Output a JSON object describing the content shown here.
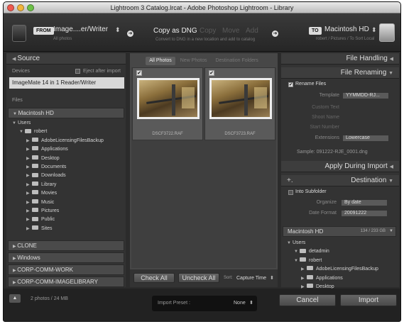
{
  "window": {
    "title": "Lightroom 3 Catalog.lrcat - Adobe Photoshop Lightroom - Library"
  },
  "header": {
    "from_label": "FROM",
    "source_name": "Image....er/Writer",
    "source_sub": "All photos",
    "modes": {
      "active": "Copy as DNG",
      "copy": "Copy",
      "move": "Move",
      "add": "Add"
    },
    "mode_description": "Convert to DNG in a new location and add to catalog",
    "to_label": "TO",
    "dest_name": "Macintosh HD",
    "dest_path": "robert / Pictures / To Sort Local"
  },
  "source_panel": {
    "title": "Source",
    "devices_label": "Devices",
    "eject_label": "Eject after import",
    "device_name": "ImageMate 14 in 1 Reader/Writer",
    "files_label": "Files",
    "volume": "Macintosh HD",
    "tree": [
      {
        "label": "Users",
        "level": 0
      },
      {
        "label": "robert",
        "level": 1
      },
      {
        "label": "AdobeLicensingFilesBackup",
        "level": 2
      },
      {
        "label": "Applications",
        "level": 2
      },
      {
        "label": "Desktop",
        "level": 2
      },
      {
        "label": "Documents",
        "level": 2
      },
      {
        "label": "Downloads",
        "level": 2
      },
      {
        "label": "Library",
        "level": 2
      },
      {
        "label": "Movies",
        "level": 2
      },
      {
        "label": "Music",
        "level": 2
      },
      {
        "label": "Pictures",
        "level": 2
      },
      {
        "label": "Public",
        "level": 2
      },
      {
        "label": "Sites",
        "level": 2
      }
    ],
    "volumes": [
      "CLONE",
      "Windows",
      "CORP-COMM-WORK",
      "CORP-COMM-IMAGELIBRARY"
    ]
  },
  "grid": {
    "tabs": [
      "All Photos",
      "New Photos",
      "Destination Folders"
    ],
    "photos": [
      {
        "name": "DSCF3722.RAF",
        "checked": true
      },
      {
        "name": "DSCF3723.RAF",
        "checked": true
      }
    ],
    "check_all": "Check All",
    "uncheck_all": "Uncheck All",
    "sort_label": "Sort:",
    "sort_value": "Capture Time"
  },
  "right_panel": {
    "file_handling": "File Handling",
    "file_renaming": "File Renaming",
    "rename_files": "Rename Files",
    "template_label": "Template",
    "template_value": "YYMMDD-RJ...",
    "custom_text": "Custom Text",
    "shoot_name": "Shoot Name",
    "start_number": "Start Number",
    "extensions_label": "Extensions",
    "extensions_value": "Lowercase",
    "sample": "Sample: 091222-RJE_0001.dng",
    "apply_during_import": "Apply During Import",
    "destination": "Destination",
    "into_subfolder": "Into Subfolder",
    "organize_label": "Organize",
    "organize_value": "By date",
    "date_format_label": "Date Format",
    "date_format_value": "20091222",
    "dest_volume": "Macintosh HD",
    "dest_volume_size": "134 / 233 GB",
    "dest_tree": [
      {
        "label": "Users",
        "level": 0
      },
      {
        "label": "detadmin",
        "level": 1
      },
      {
        "label": "robert",
        "level": 1
      },
      {
        "label": "AdobeLicensingFilesBackup",
        "level": 2
      },
      {
        "label": "Applications",
        "level": 2
      },
      {
        "label": "Desktop",
        "level": 2
      }
    ]
  },
  "footer": {
    "summary": "2 photos / 24 MB",
    "preset_label": "Import Preset :",
    "preset_value": "None",
    "cancel": "Cancel",
    "import": "Import"
  }
}
